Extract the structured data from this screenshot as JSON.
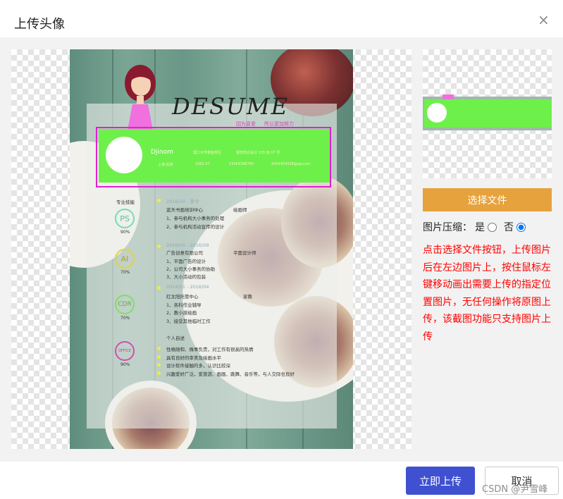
{
  "dialog": {
    "title": "上传头像",
    "close_icon": "close-icon"
  },
  "image": {
    "title": "DESUME",
    "slogan1": "因为喜爱",
    "slogan2": "所以更加努力",
    "name": "Djinom",
    "school": "理工大学黄金校区",
    "address": "视觉传达设计 135 班 07 号",
    "location": "上海 虹桥",
    "birth": "1992.07",
    "phone": "13164398760",
    "email": "2424454328@qq.com",
    "skills_title": "专业技能",
    "skills": [
      {
        "name": "PS",
        "pct": "90%",
        "color": "#6fe0b8"
      },
      {
        "name": "AI",
        "pct": "70%",
        "color": "#e8d040"
      },
      {
        "name": "CDR",
        "pct": "70%",
        "color": "#80e060"
      },
      {
        "name": "OFFICE",
        "pct": "90%",
        "color": "#d050b0"
      }
    ],
    "jobs": [
      {
        "date": "2016/10 - 至今",
        "company": "蓝天书画培训中心",
        "role": "绘画师",
        "items": [
          "1、参与机构大小事务的处理",
          "2、参与机构活动宣传的设计"
        ]
      },
      {
        "date": "2016/05 - 2016/09",
        "company": "广告创意有限公司",
        "role": "平面设计师",
        "items": [
          "1、平面广告的设计",
          "2、公司大小事务的协助",
          "3、大小活动的包装"
        ]
      },
      {
        "date": "2014/11 - 2016/04",
        "company": "红太阳托管中心",
        "role": "家教",
        "items": [
          "1、各科作业辅导",
          "2、教小孩绘画",
          "3、接受其他临时工作"
        ]
      }
    ],
    "intro_title": "个人自述",
    "intro": [
      "性格随和、做事负责，对工作有很高的热情",
      "具有良好的审美及绘画水平",
      "设计软件接触的多，认识比较深",
      "兴趣爱好广泛，爱旅游、画画、跳舞、音乐等，与人交际也良好"
    ]
  },
  "sidebar": {
    "choose_file": "选择文件",
    "compress_label": "图片压缩：",
    "yes": "是",
    "no": "否",
    "compress_selected": "否",
    "tip": "点击选择文件按钮，上传图片后在左边图片上，按住鼠标左键移动画出需要上传的指定位置图片，无任何操作将原图上传，该截图功能只支持图片上传"
  },
  "footer": {
    "upload": "立即上传",
    "cancel": "取消",
    "watermark": "CSDN @尹雪峰"
  },
  "colors": {
    "primary": "#3f51d0",
    "choose": "#e6a23c",
    "tip": "#ff0000",
    "selection": "#e020d0"
  }
}
